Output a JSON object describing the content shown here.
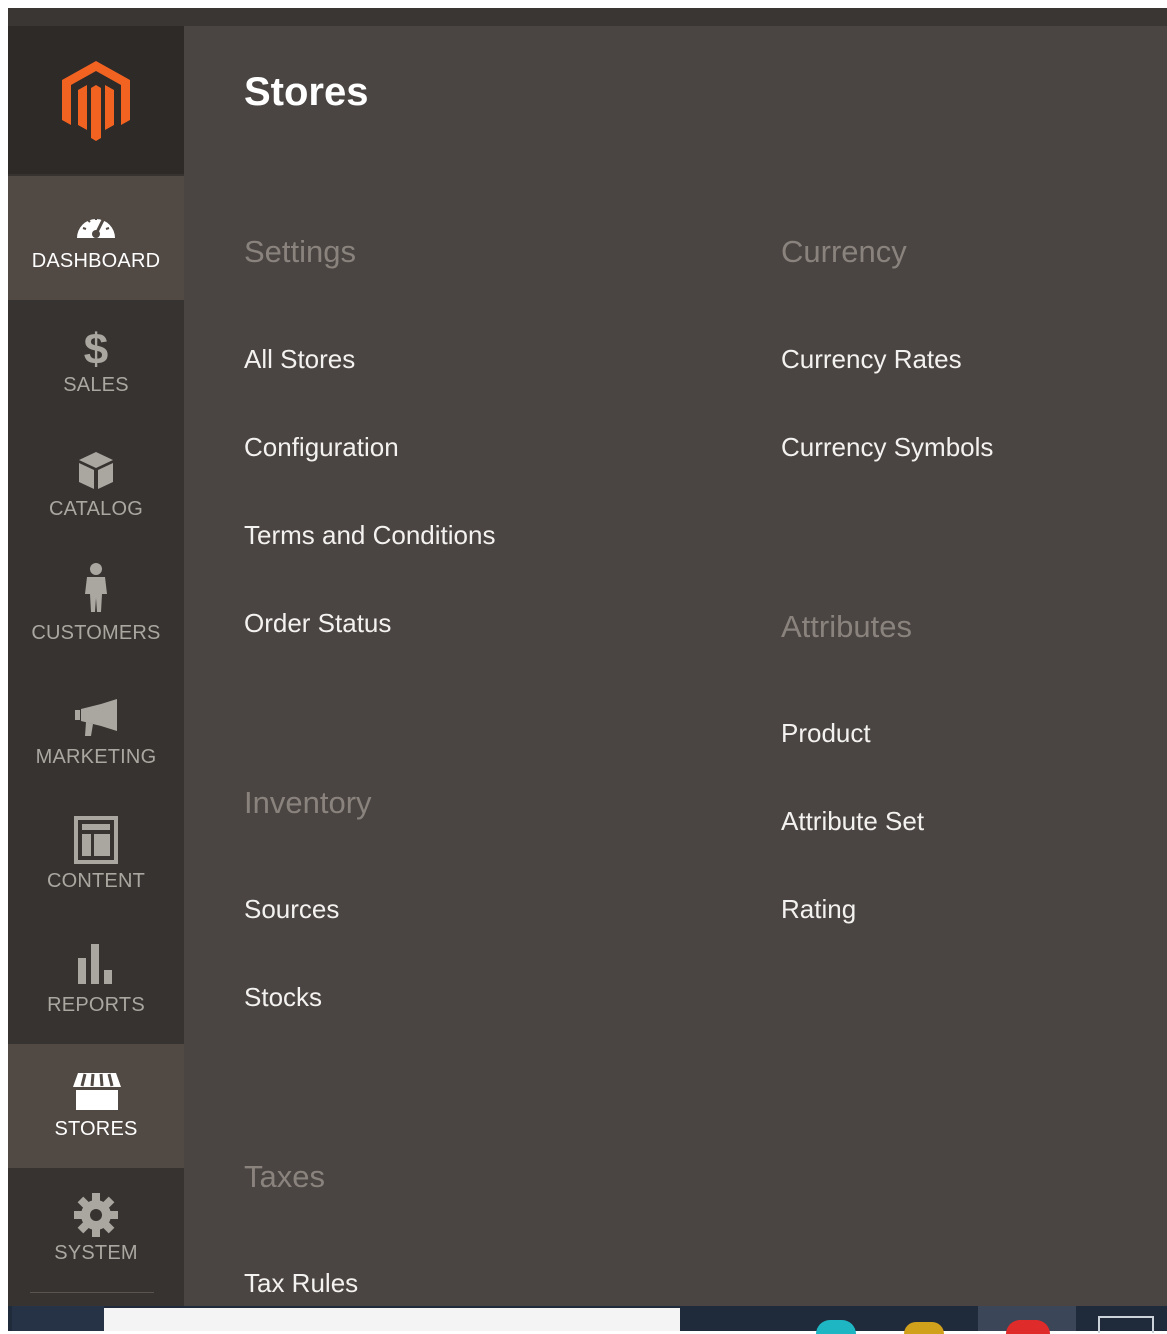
{
  "brand": {
    "logo_icon": "magento-logo-icon",
    "accent": "#f26322"
  },
  "sidebar": {
    "items": [
      {
        "label": "DASHBOARD",
        "icon": "dashboard-gauge-icon",
        "active": false,
        "highlight": true
      },
      {
        "label": "SALES",
        "icon": "dollar-icon",
        "active": false
      },
      {
        "label": "CATALOG",
        "icon": "catalog-box-icon",
        "active": false
      },
      {
        "label": "CUSTOMERS",
        "icon": "customer-person-icon",
        "active": false
      },
      {
        "label": "MARKETING",
        "icon": "megaphone-icon",
        "active": false
      },
      {
        "label": "CONTENT",
        "icon": "content-layout-icon",
        "active": false
      },
      {
        "label": "REPORTS",
        "icon": "bar-chart-icon",
        "active": false
      },
      {
        "label": "STORES",
        "icon": "storefront-icon",
        "active": true
      },
      {
        "label": "SYSTEM",
        "icon": "gear-icon",
        "active": false
      }
    ]
  },
  "panel": {
    "title": "Stores",
    "sections": {
      "settings": {
        "title": "Settings",
        "links": [
          "All Stores",
          "Configuration",
          "Terms and Conditions",
          "Order Status"
        ]
      },
      "inventory": {
        "title": "Inventory",
        "links": [
          "Sources",
          "Stocks"
        ]
      },
      "taxes": {
        "title": "Taxes",
        "links": [
          "Tax Rules"
        ]
      },
      "currency": {
        "title": "Currency",
        "links": [
          "Currency Rates",
          "Currency Symbols"
        ]
      },
      "attributes": {
        "title": "Attributes",
        "links": [
          "Product",
          "Attribute Set",
          "Rating"
        ]
      }
    }
  },
  "colors": {
    "sidebar_bg": "#373330",
    "sidebar_active_bg": "#514943",
    "panel_bg": "#4a4542",
    "section_title": "#8a837d",
    "link_text": "#f4f2f0"
  }
}
